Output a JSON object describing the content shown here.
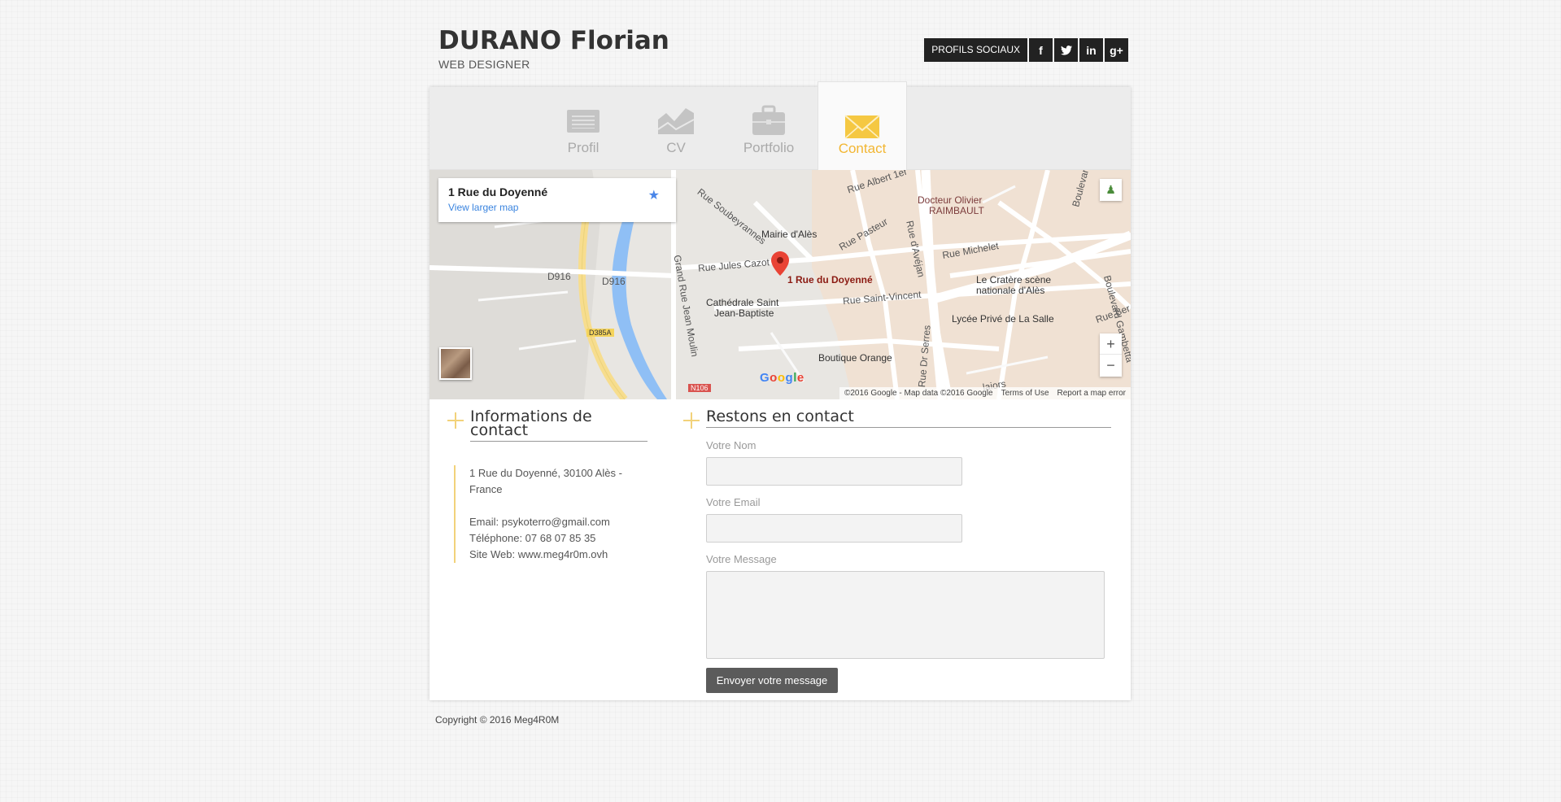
{
  "header": {
    "name": "DURANO Florian",
    "subtitle": "WEB DESIGNER",
    "social_label": "PROFILS SOCIAUX",
    "social_icons": [
      "facebook-icon",
      "twitter-icon",
      "linkedin-icon",
      "google-plus-icon"
    ],
    "social_glyphs": [
      "f",
      "t",
      "in",
      "g+"
    ]
  },
  "nav": {
    "tabs": [
      {
        "label": "Profil",
        "icon": "profile-icon"
      },
      {
        "label": "CV",
        "icon": "chart-icon"
      },
      {
        "label": "Portfolio",
        "icon": "briefcase-icon"
      },
      {
        "label": "Contact",
        "icon": "envelope-icon",
        "active": true
      }
    ]
  },
  "map": {
    "card_address": "1 Rue du Doyenné",
    "card_link": "View larger map",
    "marker_label": "1 Rue du Doyenné",
    "labels": [
      "Rue Albert 1er",
      "Docteur Olivier",
      "RAIMBAULT",
      "Boulevard",
      "Mairie d'Alès",
      "Rue Pasteur",
      "Rue Soubeyrannes",
      "Rue d'Avéjan",
      "Rue Michelet",
      "Rue Jules Cazot",
      "D916",
      "D916",
      "Le Cratère scène",
      "nationale d'Alès",
      "Grand Rue Jean Moulin",
      "Cathédrale Saint",
      "Jean-Baptiste",
      "Rue Saint-Vincent",
      "Lycée Privé de La Salle",
      "Boulevard Gambetta",
      "Rue Ber",
      "Boutique Orange",
      "Rue Dr Serres",
      "D385A",
      "N106",
      "laiors"
    ],
    "google": "Google",
    "footer": {
      "data": "©2016 Google - Map data ©2016 Google",
      "terms": "Terms of Use",
      "report": "Report a map error"
    }
  },
  "info": {
    "title": "Informations de contact",
    "address": "1 Rue du Doyenné, 30100 Alès - France",
    "email": "Email: psykoterro@gmail.com",
    "phone": "Téléphone: 07 68 07 85 35",
    "site": "Site Web: www.meg4r0m.ovh"
  },
  "form": {
    "title": "Restons en contact",
    "name_label": "Votre Nom",
    "email_label": "Votre Email",
    "message_label": "Votre Message",
    "submit": "Envoyer votre message"
  },
  "footer": {
    "copyright": "Copyright © 2016 Meg4R0M"
  },
  "colors": {
    "accent": "#f2b632",
    "plus": "#f2d27a",
    "button": "#5b5b5b"
  }
}
